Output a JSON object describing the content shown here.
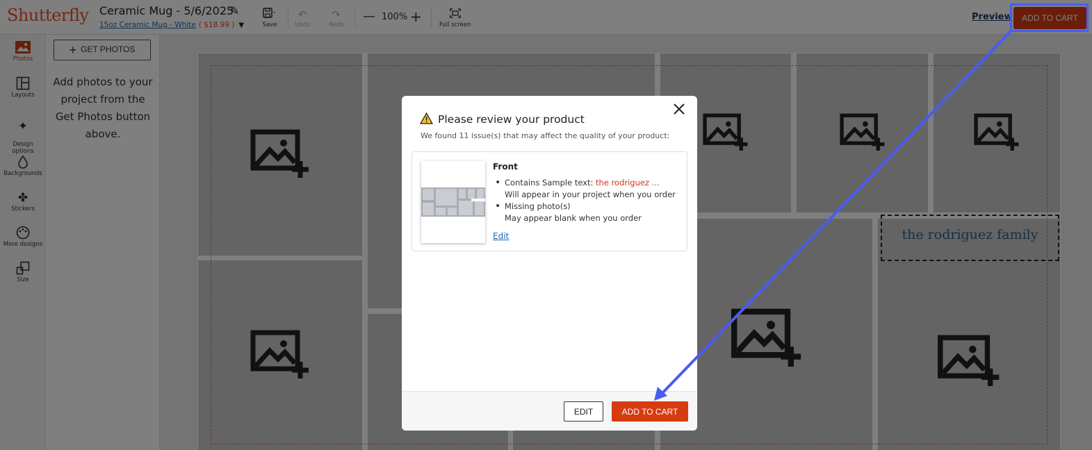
{
  "header": {
    "logo": "Shutterfly",
    "project_title": "Ceramic Mug - 5/6/2025",
    "product_link": "15oz Ceramic Mug - White",
    "product_price": "( $18.99 )",
    "tools": {
      "save": "Save",
      "undo": "Undo",
      "redo": "Redo",
      "zoom": "100%",
      "fullscreen": "Full screen"
    },
    "preview": "Preview",
    "add_to_cart": "ADD TO CART"
  },
  "sidebar": {
    "items": [
      {
        "label": "Photos",
        "icon": "photos-icon"
      },
      {
        "label": "Layouts",
        "icon": "layouts-icon"
      },
      {
        "label": "Design\noptions",
        "icon": "design-options-icon"
      },
      {
        "label": "Backgrounds",
        "icon": "backgrounds-icon"
      },
      {
        "label": "Stickers",
        "icon": "stickers-icon"
      },
      {
        "label": "More designs",
        "icon": "more-designs-icon"
      },
      {
        "label": "Size",
        "icon": "size-icon"
      }
    ]
  },
  "panel": {
    "get_photos": "GET PHOTOS",
    "message": "Add photos to your project from the Get Photos button above."
  },
  "canvas": {
    "text_box": "the rodriguez family"
  },
  "modal": {
    "title": "Please review your product",
    "subtitle": "We found 11 issue(s) that may affect the quality of your product:",
    "card_heading": "Front",
    "issue1_prefix": "Contains Sample text: ",
    "issue1_sample": "the rodriguez ...",
    "issue1_detail": "Will appear in your project when you order",
    "issue2": "Missing photo(s)",
    "issue2_detail": "May appear blank when you order",
    "edit_link": "Edit",
    "edit_button": "EDIT",
    "add_to_cart_button": "ADD TO CART"
  },
  "colors": {
    "brand": "#e8532c",
    "cart_button": "#d73b10",
    "annotation": "#4a5cf0",
    "link": "#1a66b5"
  }
}
